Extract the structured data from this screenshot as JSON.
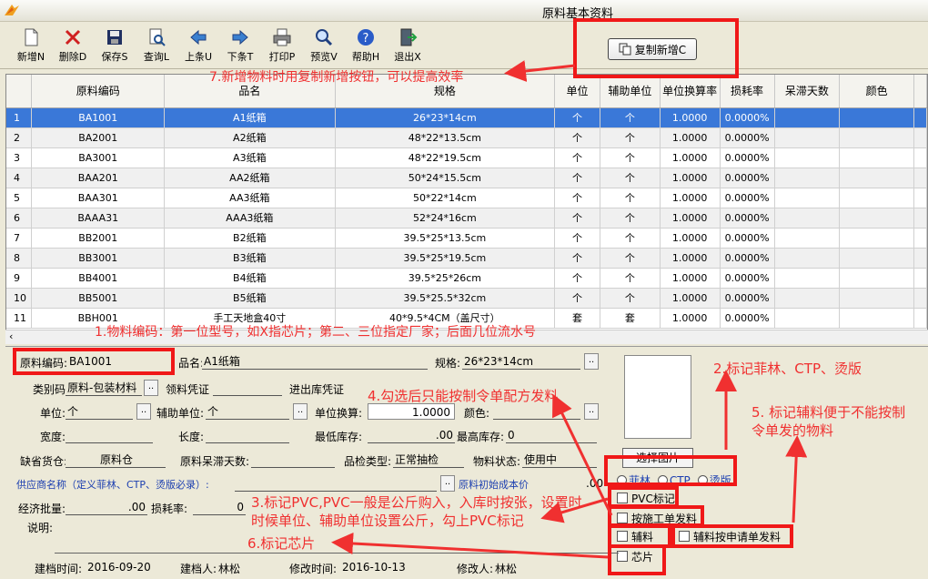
{
  "window": {
    "title": "原料基本资料"
  },
  "toolbar": {
    "buttons": [
      {
        "label": "新增N",
        "icon": "new-file-icon"
      },
      {
        "label": "删除D",
        "icon": "delete-x-icon"
      },
      {
        "label": "保存S",
        "icon": "save-disk-icon"
      },
      {
        "label": "查询L",
        "icon": "query-icon"
      },
      {
        "label": "上条U",
        "icon": "arrow-left-icon"
      },
      {
        "label": "下条T",
        "icon": "arrow-right-icon"
      },
      {
        "label": "打印P",
        "icon": "printer-icon"
      },
      {
        "label": "预览V",
        "icon": "magnifier-icon"
      },
      {
        "label": "帮助H",
        "icon": "help-icon"
      },
      {
        "label": "退出X",
        "icon": "exit-icon"
      }
    ],
    "copy_new_label": "复制新增C"
  },
  "grid": {
    "columns": [
      "",
      "原料编码",
      "品名",
      "规格",
      "单位",
      "辅助单位",
      "单位换算率",
      "损耗率",
      "呆滞天数",
      "颜色"
    ],
    "rows": [
      [
        "1",
        "BA1001",
        "A1纸箱",
        "26*23*14cm",
        "个",
        "个",
        "1.0000",
        "0.0000%",
        "",
        ""
      ],
      [
        "2",
        "BA2001",
        "A2纸箱",
        "48*22*13.5cm",
        "个",
        "个",
        "1.0000",
        "0.0000%",
        "",
        ""
      ],
      [
        "3",
        "BA3001",
        "A3纸箱",
        "48*22*19.5cm",
        "个",
        "个",
        "1.0000",
        "0.0000%",
        "",
        ""
      ],
      [
        "4",
        "BAA201",
        "AA2纸箱",
        "50*24*15.5cm",
        "个",
        "个",
        "1.0000",
        "0.0000%",
        "",
        ""
      ],
      [
        "5",
        "BAA301",
        "AA3纸箱",
        "50*22*14cm",
        "个",
        "个",
        "1.0000",
        "0.0000%",
        "",
        ""
      ],
      [
        "6",
        "BAAA31",
        "AAA3纸箱",
        "52*24*16cm",
        "个",
        "个",
        "1.0000",
        "0.0000%",
        "",
        ""
      ],
      [
        "7",
        "BB2001",
        "B2纸箱",
        "39.5*25*13.5cm",
        "个",
        "个",
        "1.0000",
        "0.0000%",
        "",
        ""
      ],
      [
        "8",
        "BB3001",
        "B3纸箱",
        "39.5*25*19.5cm",
        "个",
        "个",
        "1.0000",
        "0.0000%",
        "",
        ""
      ],
      [
        "9",
        "BB4001",
        "B4纸箱",
        "39.5*25*26cm",
        "个",
        "个",
        "1.0000",
        "0.0000%",
        "",
        ""
      ],
      [
        "10",
        "BB5001",
        "B5纸箱",
        "39.5*25.5*32cm",
        "个",
        "个",
        "1.0000",
        "0.0000%",
        "",
        ""
      ],
      [
        "11",
        "BBH001",
        "手工天地盒40寸",
        "40*9.5*4CM（盖尺寸）",
        "套",
        "套",
        "1.0000",
        "0.0000%",
        "",
        ""
      ]
    ]
  },
  "form": {
    "code_label": "原料编码:",
    "code_value": "BA1001",
    "name_label": "品名:",
    "name_value": "A1纸箱",
    "spec_label": "规格:",
    "spec_value": "26*23*14cm",
    "category_label": "类别码",
    "category_value": "原料-包装材料",
    "issue_voucher_label": "领料凭证",
    "io_voucher_label": "进出库凭证",
    "unit_label": "单位:",
    "unit_value": "个",
    "aux_unit_label": "辅助单位:",
    "aux_unit_value": "个",
    "conversion_label": "单位换算:",
    "conversion_value": "1.0000",
    "color_label": "颜色:",
    "width_label": "宽度:",
    "length_label": "长度:",
    "min_stock_label": "最低库存:",
    "min_stock_value": ".00",
    "max_stock_label": "最高库存:",
    "max_stock_value": "0",
    "default_warehouse_label": "缺省货仓:",
    "default_warehouse_value": "原料仓",
    "idle_days_label": "原料呆滞天数:",
    "inspection_label": "品检类型:",
    "inspection_value": "正常抽检",
    "status_label": "物料状态:",
    "status_value": "使用中",
    "supplier_label": "供应商名称（定义菲林、CTP、烫版必录）:",
    "init_cost_label": "原料初始成本价",
    "init_cost_value": ".00",
    "economic_batch_label": "经济批量:",
    "economic_batch_value": ".00",
    "loss_rate_label": "损耗率:",
    "loss_rate_value": "0",
    "remark_label": "说明:",
    "select_photo_label": "选择图片",
    "radio_options": [
      "菲林",
      "CTP",
      "烫版"
    ],
    "checkbox_pvc": "PVC标记",
    "checkbox_by_order": "按施工单发料",
    "checkbox_aux": "辅料",
    "checkbox_aux_request": "辅料按申请单发料",
    "checkbox_chip": "芯片",
    "created_time_label": "建档时间:",
    "created_time_value": "2016-09-20",
    "creator_label": "建档人:",
    "creator_value": "林松",
    "modified_time_label": "修改时间:",
    "modified_time_value": "2016-10-13",
    "modifier_label": "修改人:",
    "modifier_value": "林松"
  },
  "annotations": {
    "a1": "1.物料编码：第一位型号，如X指芯片；第二、三位指定厂家；后面几位流水号",
    "a2": "2.标记菲林、CTP、烫版",
    "a3_line1": "3.标记PVC,PVC一般是公斤购入，入库时按张，设置时",
    "a3_line2": "时候单位、辅助单位设置公斤，勾上PVC标记",
    "a4": "4.勾选后只能按制令单配方发料",
    "a5_line1": "5. 标记辅料便于不能按制",
    "a5_line2": "令单发的物料",
    "a6": "6.标记芯片",
    "a7": "7.新增物料时用复制新增按钮，可以提高效率"
  },
  "colors": {
    "annotation": "#f03030",
    "selection": "#3a78d8"
  }
}
